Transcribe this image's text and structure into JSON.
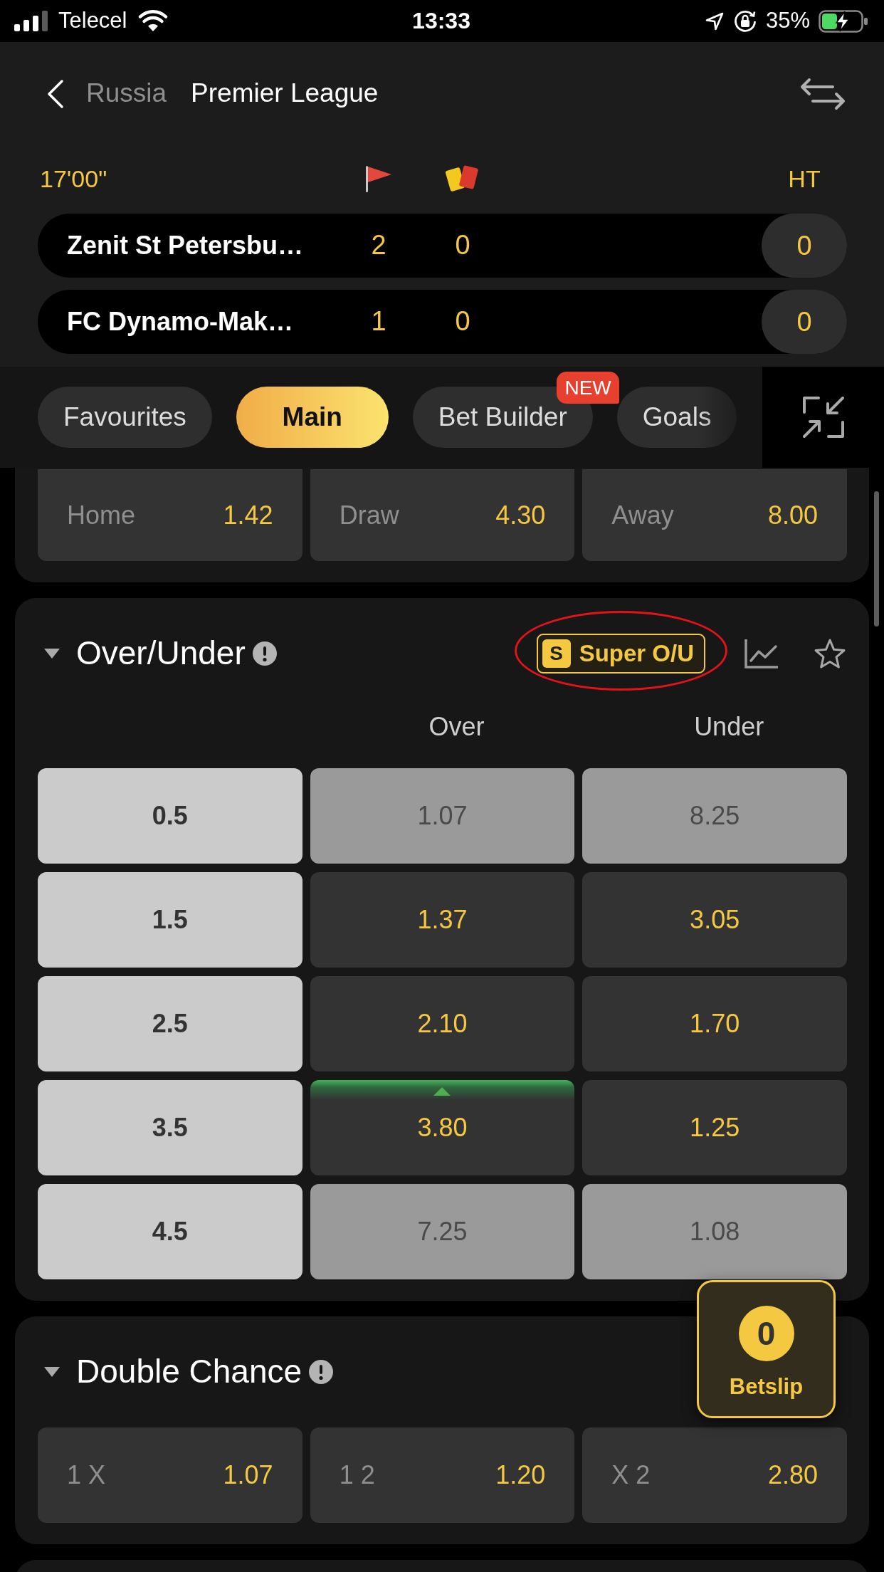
{
  "status_bar": {
    "carrier": "Telecel",
    "time": "13:33",
    "battery": "35%"
  },
  "header": {
    "breadcrumb": "Russia",
    "title": "Premier League"
  },
  "match": {
    "clock": "17'00\"",
    "ht_label": "HT",
    "teams": [
      {
        "name": "Zenit St Petersbu…",
        "corners": "2",
        "cards": "0",
        "ht_score": "0"
      },
      {
        "name": "FC Dynamo-Mak…",
        "corners": "1",
        "cards": "0",
        "ht_score": "0"
      }
    ]
  },
  "tabs": [
    {
      "label": "Favourites",
      "selected": false
    },
    {
      "label": "Main",
      "selected": true
    },
    {
      "label": "Bet Builder",
      "selected": false,
      "badge": "NEW"
    },
    {
      "label": "Goals",
      "selected": false
    }
  ],
  "markets": [
    {
      "kind": "three_way",
      "selections": [
        {
          "label": "Home",
          "odds": "1.42"
        },
        {
          "label": "Draw",
          "odds": "4.30"
        },
        {
          "label": "Away",
          "odds": "8.00"
        }
      ]
    },
    {
      "kind": "lines",
      "title": "Over/Under",
      "expanded": true,
      "super_button": {
        "badge": "S",
        "label": "Super O/U"
      },
      "columns": [
        "Over",
        "Under"
      ],
      "rows": [
        {
          "line": "0.5",
          "odds": [
            {
              "value": "1.07",
              "suspended": true,
              "rising": false
            },
            {
              "value": "8.25",
              "suspended": true,
              "rising": false
            }
          ]
        },
        {
          "line": "1.5",
          "odds": [
            {
              "value": "1.37",
              "suspended": false,
              "rising": false
            },
            {
              "value": "3.05",
              "suspended": false,
              "rising": false
            }
          ]
        },
        {
          "line": "2.5",
          "odds": [
            {
              "value": "2.10",
              "suspended": false,
              "rising": false
            },
            {
              "value": "1.70",
              "suspended": false,
              "rising": false
            }
          ]
        },
        {
          "line": "3.5",
          "odds": [
            {
              "value": "3.80",
              "suspended": false,
              "rising": true
            },
            {
              "value": "1.25",
              "suspended": false,
              "rising": false
            }
          ]
        },
        {
          "line": "4.5",
          "odds": [
            {
              "value": "7.25",
              "suspended": true,
              "rising": false
            },
            {
              "value": "1.08",
              "suspended": true,
              "rising": false
            }
          ]
        }
      ]
    },
    {
      "kind": "three_way",
      "title": "Double Chance",
      "expanded": true,
      "selections": [
        {
          "label": "1 X",
          "odds": "1.07"
        },
        {
          "label": "1 2",
          "odds": "1.20"
        },
        {
          "label": "X 2",
          "odds": "2.80"
        }
      ]
    }
  ],
  "betslip": {
    "count": "0",
    "label": "Betslip"
  }
}
